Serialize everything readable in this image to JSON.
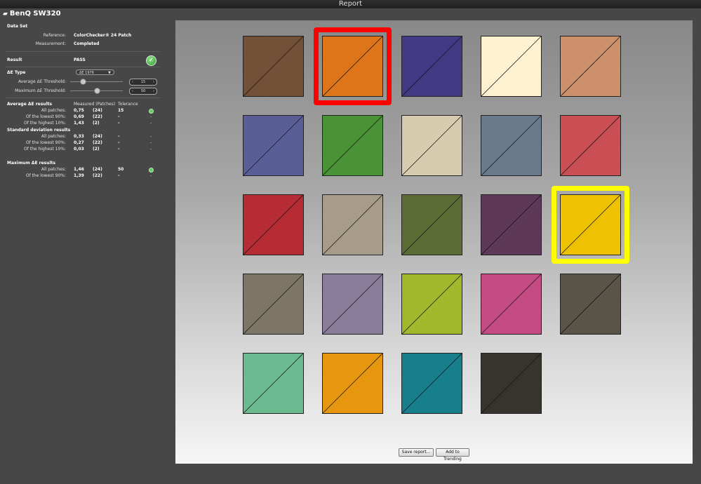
{
  "window": {
    "title": "Report"
  },
  "device": {
    "name": "BenQ SW320",
    "icon": "display-icon"
  },
  "dataset": {
    "header": "Data Set",
    "reference_label": "Reference:",
    "reference_value": "ColorChecker® 24 Patch",
    "measurement_label": "Measurement:",
    "measurement_value": "Completed"
  },
  "result": {
    "label": "Result",
    "value": "PASS",
    "status_icon": "check-circle-icon",
    "status_color": "#3aa63a"
  },
  "delta_e": {
    "header": "ΔE Type",
    "type_selected": "ΔE 1976",
    "avg_label": "Average  ΔE Threshold:",
    "avg_value": "15",
    "max_label": "Maximum ΔE Threshold:",
    "max_value": "50"
  },
  "average_results": {
    "header": "Average ΔE results",
    "col_measured": "Measured (Patches)",
    "col_tolerance": "Tolerance",
    "rows": [
      {
        "label": "All patches:",
        "measured": "0,75",
        "patches": "(24)",
        "tolerance": "15",
        "status": "check"
      },
      {
        "label": "Of the lowest 90%:",
        "measured": "0,69",
        "patches": "(22)",
        "tolerance": "-",
        "status": "-"
      },
      {
        "label": "Of the highest 10%:",
        "measured": "1,43",
        "patches": "(2)",
        "tolerance": "-",
        "status": "-"
      }
    ]
  },
  "std_results": {
    "header": "Standard deviation results",
    "rows": [
      {
        "label": "All patches:",
        "measured": "0,33",
        "patches": "(24)",
        "tolerance": "-",
        "status": "-"
      },
      {
        "label": "Of the lowest 90%:",
        "measured": "0,27",
        "patches": "(22)",
        "tolerance": "-",
        "status": "-"
      },
      {
        "label": "Of the highest 10%:",
        "measured": "0,03",
        "patches": "(2)",
        "tolerance": "-",
        "status": "-"
      }
    ]
  },
  "max_results": {
    "header": "Maximum ΔE results",
    "rows": [
      {
        "label": "All patches:",
        "measured": "1,46",
        "patches": "(24)",
        "tolerance": "50",
        "status": "check"
      },
      {
        "label": "Of the lowest 90%:",
        "measured": "1,39",
        "patches": "(22)",
        "tolerance": "-",
        "status": "-"
      }
    ]
  },
  "patches": [
    {
      "color": "#735038",
      "highlight": ""
    },
    {
      "color": "#de751b",
      "highlight": "#ff0000"
    },
    {
      "color": "#433a86",
      "highlight": ""
    },
    {
      "color": "#fdf1d1",
      "highlight": ""
    },
    {
      "color": "#cc916b",
      "highlight": ""
    },
    {
      "color": "#5a5e97",
      "highlight": ""
    },
    {
      "color": "#4a9236",
      "highlight": ""
    },
    {
      "color": "#d7cbb0",
      "highlight": ""
    },
    {
      "color": "#687a8b",
      "highlight": ""
    },
    {
      "color": "#c94f55",
      "highlight": ""
    },
    {
      "color": "#b62b34",
      "highlight": ""
    },
    {
      "color": "#a69c89",
      "highlight": ""
    },
    {
      "color": "#5d6b35",
      "highlight": ""
    },
    {
      "color": "#5e3858",
      "highlight": ""
    },
    {
      "color": "#eec200",
      "highlight": "#ffff00"
    },
    {
      "color": "#7d7666",
      "highlight": ""
    },
    {
      "color": "#8a7d9c",
      "highlight": ""
    },
    {
      "color": "#a1b72c",
      "highlight": ""
    },
    {
      "color": "#c54c83",
      "highlight": ""
    },
    {
      "color": "#5a5348",
      "highlight": ""
    },
    {
      "color": "#6cba8f",
      "highlight": ""
    },
    {
      "color": "#e7970f",
      "highlight": ""
    },
    {
      "color": "#177f8c",
      "highlight": ""
    },
    {
      "color": "#37332d",
      "highlight": ""
    }
  ],
  "buttons": {
    "save": "Save report...",
    "trending": "Add to Trending"
  }
}
